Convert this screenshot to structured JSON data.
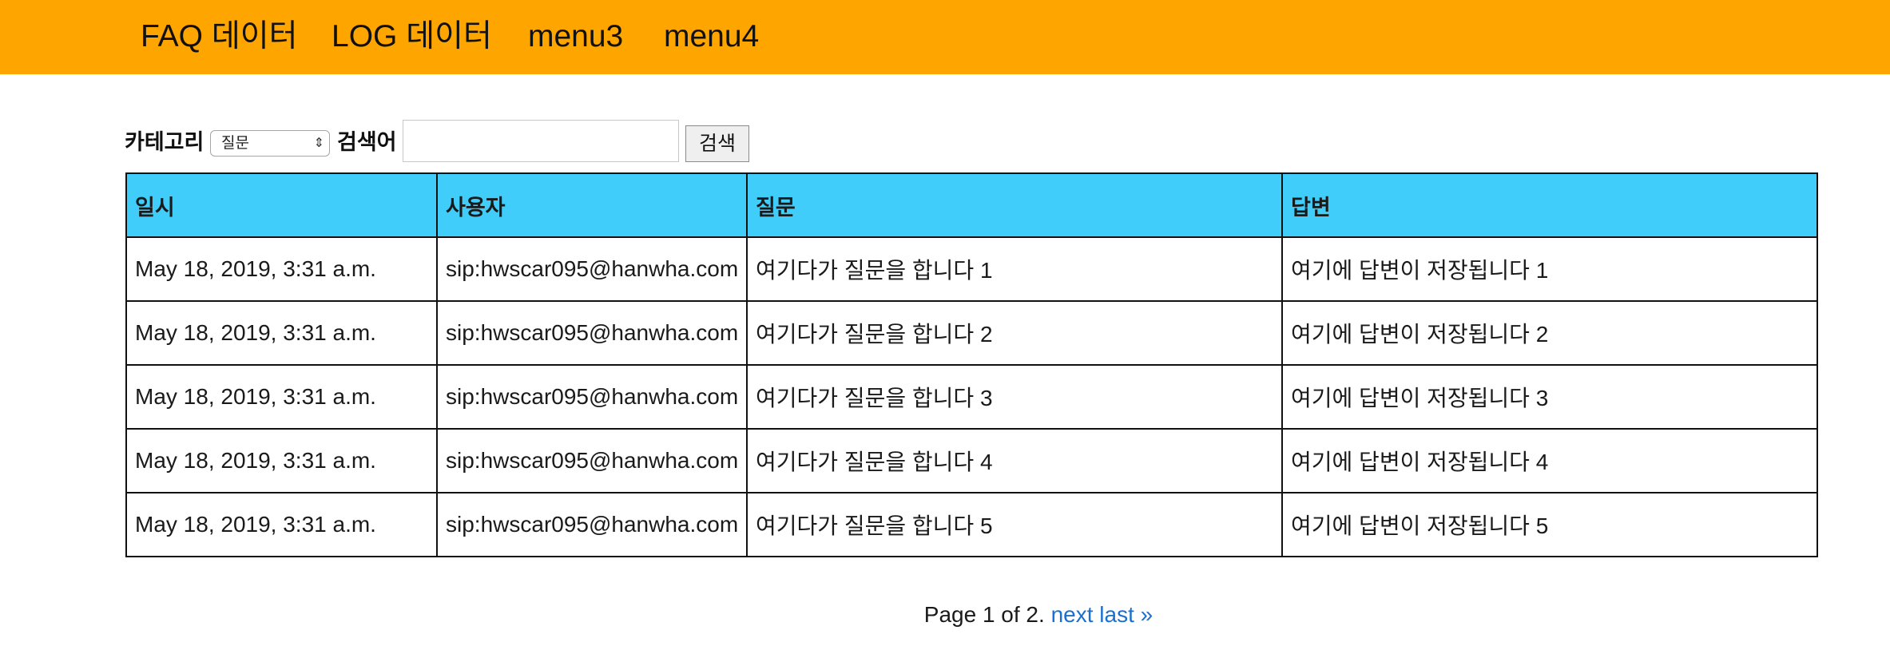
{
  "nav": {
    "items": [
      {
        "label": "FAQ 데이터"
      },
      {
        "label": "LOG 데이터"
      },
      {
        "label": "menu3"
      },
      {
        "label": "menu4"
      }
    ],
    "background_color": "#FFA500"
  },
  "search": {
    "category_label": "카테고리",
    "category_selected": "질문",
    "keyword_label": "검색어",
    "keyword_value": "",
    "button_label": "검색"
  },
  "table": {
    "header_color": "#40CDFA",
    "columns": [
      "일시",
      "사용자",
      "질문",
      "답변"
    ],
    "rows": [
      [
        "May 18, 2019, 3:31 a.m.",
        "sip:hwscar095@hanwha.com",
        "여기다가 질문을 합니다 1",
        "여기에 답변이 저장됩니다 1"
      ],
      [
        "May 18, 2019, 3:31 a.m.",
        "sip:hwscar095@hanwha.com",
        "여기다가 질문을 합니다 2",
        "여기에 답변이 저장됩니다 2"
      ],
      [
        "May 18, 2019, 3:31 a.m.",
        "sip:hwscar095@hanwha.com",
        "여기다가 질문을 합니다 3",
        "여기에 답변이 저장됩니다 3"
      ],
      [
        "May 18, 2019, 3:31 a.m.",
        "sip:hwscar095@hanwha.com",
        "여기다가 질문을 합니다 4",
        "여기에 답변이 저장됩니다 4"
      ],
      [
        "May 18, 2019, 3:31 a.m.",
        "sip:hwscar095@hanwha.com",
        "여기다가 질문을 합니다 5",
        "여기에 답변이 저장됩니다 5"
      ]
    ]
  },
  "pagination": {
    "status": "Page 1 of 2.",
    "next_label": "next",
    "last_label": "last »",
    "link_color": "#1a6fd0"
  }
}
